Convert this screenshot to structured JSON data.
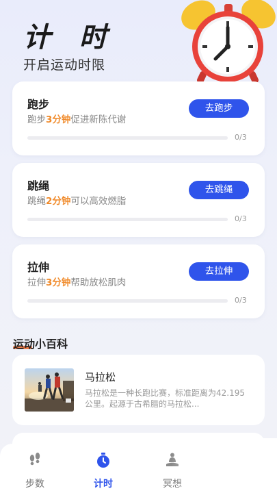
{
  "header": {
    "title": "计 时",
    "subtitle": "开启运动时限",
    "illustration": "alarm-clock-icon"
  },
  "cards": [
    {
      "title": "跑步",
      "desc_before": "跑步",
      "desc_highlight": "3分钟",
      "desc_after": "促进新陈代谢",
      "button": "去跑步",
      "progress_text": "0/3",
      "progress_done": 0,
      "progress_total": 3
    },
    {
      "title": "跳绳",
      "desc_before": "跳绳",
      "desc_highlight": "2分钟",
      "desc_after": "可以高效燃脂",
      "button": "去跳绳",
      "progress_text": "0/3",
      "progress_done": 0,
      "progress_total": 3
    },
    {
      "title": "拉伸",
      "desc_before": "拉伸",
      "desc_highlight": "3分钟",
      "desc_after": "帮助放松肌肉",
      "button": "去拉伸",
      "progress_text": "0/3",
      "progress_done": 0,
      "progress_total": 3
    }
  ],
  "encyclopedia": {
    "section_title": "运动小百科",
    "article": {
      "title": "马拉松",
      "text": "马拉松是一种长跑比赛，标准距离为42.195公里。起源于古希腊的马拉松...",
      "thumbnail": "runners-photo"
    }
  },
  "tabbar": {
    "tabs": [
      {
        "label": "步数",
        "icon": "footprints-icon",
        "active": false
      },
      {
        "label": "计时",
        "icon": "stopwatch-icon",
        "active": true
      },
      {
        "label": "冥想",
        "icon": "meditation-icon",
        "active": false
      }
    ]
  },
  "colors": {
    "accent": "#2f54eb",
    "highlight": "#f08a2a",
    "clock_red": "#e8423a",
    "clock_bell": "#f6c431"
  }
}
